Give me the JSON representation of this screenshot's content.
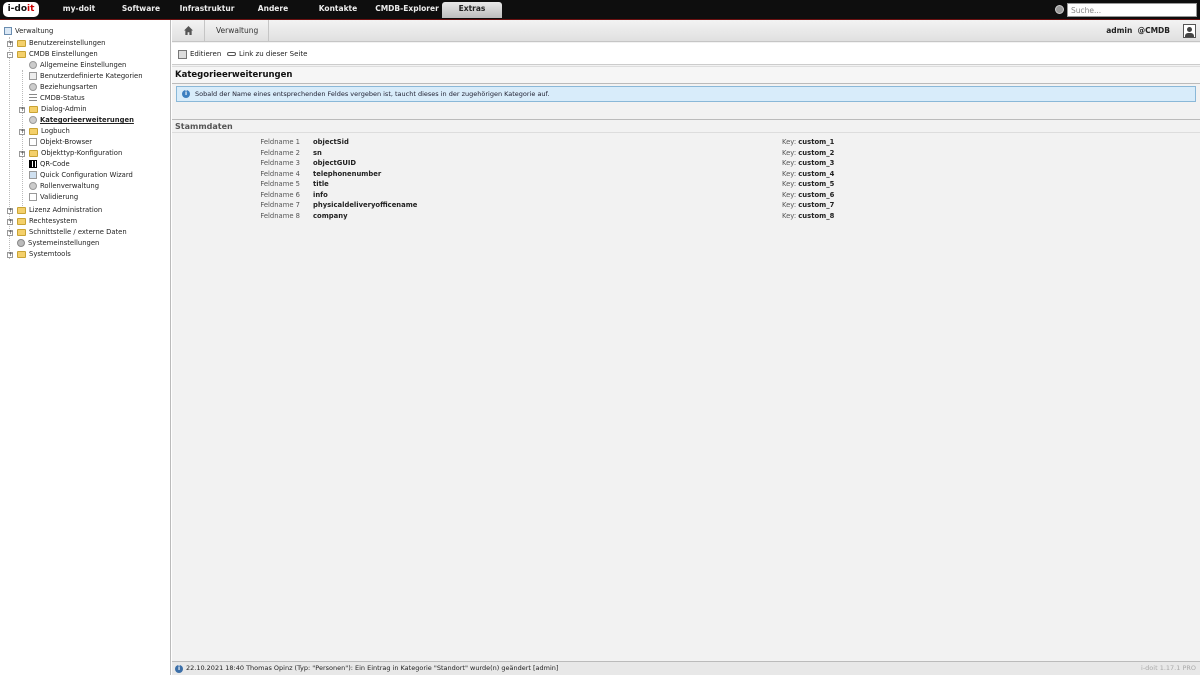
{
  "topbar": {
    "logo_main": "i-do",
    "logo_accent": "it",
    "nav": [
      "my-doit",
      "Software",
      "Infrastruktur",
      "Andere",
      "Kontakte",
      "CMDB-Explorer",
      "Extras"
    ],
    "active_nav": "Extras",
    "search_placeholder": "Suche..."
  },
  "sidebar": {
    "root": "Verwaltung",
    "items": [
      {
        "label": "Benutzereinstellungen"
      },
      {
        "label": "CMDB Einstellungen"
      },
      {
        "label": "Allgemeine Einstellungen"
      },
      {
        "label": "Benutzerdefinierte Kategorien"
      },
      {
        "label": "Beziehungsarten"
      },
      {
        "label": "CMDB-Status"
      },
      {
        "label": "Dialog-Admin"
      },
      {
        "label": "Kategorieerweiterungen"
      },
      {
        "label": "Logbuch"
      },
      {
        "label": "Objekt-Browser"
      },
      {
        "label": "Objekttyp-Konfiguration"
      },
      {
        "label": "QR-Code"
      },
      {
        "label": "Quick Configuration Wizard"
      },
      {
        "label": "Rollenverwaltung"
      },
      {
        "label": "Validierung"
      },
      {
        "label": "Lizenz Administration"
      },
      {
        "label": "Rechtesystem"
      },
      {
        "label": "Schnittstelle / externe Daten"
      },
      {
        "label": "Systemeinstellungen"
      },
      {
        "label": "Systemtools"
      }
    ]
  },
  "breadcrumb": {
    "current": "Verwaltung"
  },
  "user": {
    "name": "admin",
    "tenant": "@CMDB"
  },
  "toolbar": {
    "edit_label": "Editieren",
    "link_label": "Link zu dieser Seite"
  },
  "page": {
    "title": "Kategorieerweiterungen",
    "info": "Sobald der Name eines entsprechenden Feldes vergeben ist, taucht dieses in der zugehörigen Kategorie auf.",
    "section": "Stammdaten",
    "key_prefix": "Key: ",
    "fields": [
      {
        "label": "Feldname 1",
        "value": "objectSid",
        "key": "custom_1"
      },
      {
        "label": "Feldname 2",
        "value": "sn",
        "key": "custom_2"
      },
      {
        "label": "Feldname 3",
        "value": "objectGUID",
        "key": "custom_3"
      },
      {
        "label": "Feldname 4",
        "value": "telephonenumber",
        "key": "custom_4"
      },
      {
        "label": "Feldname 5",
        "value": "title",
        "key": "custom_5"
      },
      {
        "label": "Feldname 6",
        "value": "info",
        "key": "custom_6"
      },
      {
        "label": "Feldname 7",
        "value": "physicaldeliveryofficename",
        "key": "custom_7"
      },
      {
        "label": "Feldname 8",
        "value": "company",
        "key": "custom_8"
      }
    ]
  },
  "footer": {
    "message": "22.10.2021 18:40 Thomas Opinz (Typ: \"Personen\"): Ein Eintrag in Kategorie \"Standort\" wurde(n) geändert [admin]",
    "version": "i-doit 1.17.1 PRO"
  }
}
